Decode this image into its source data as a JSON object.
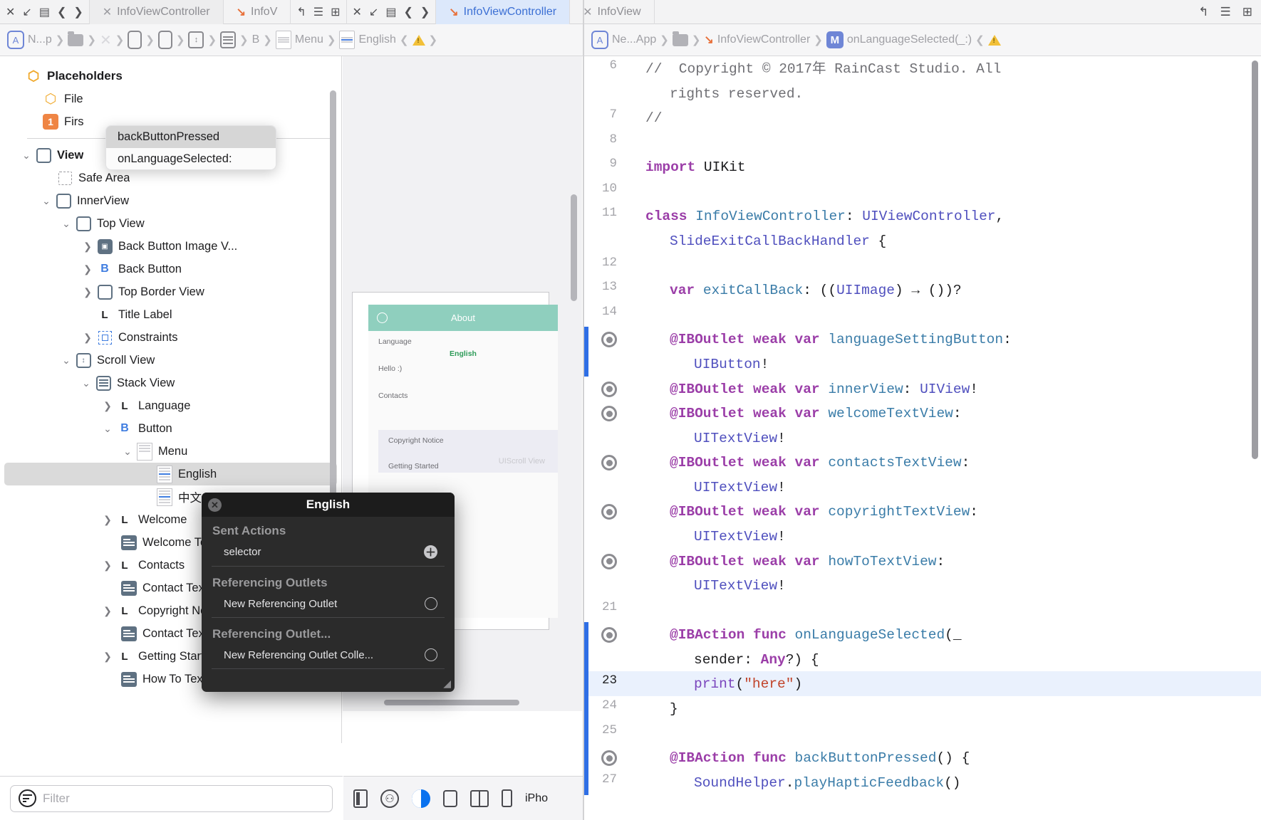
{
  "window": {
    "tabs": [
      {
        "label": "InfoViewController",
        "icon": "xib-icon",
        "state": "light"
      },
      {
        "label": "InfoV",
        "icon": "swift-icon",
        "state": "plain"
      },
      {
        "label": "InfoViewController",
        "icon": "swift-icon",
        "state": "active"
      },
      {
        "label": "InfoView",
        "icon": "xib-icon",
        "state": "plain"
      }
    ],
    "tab_controls": [
      "close-icon",
      "minimize-icon",
      "grid-icon",
      "back-chevron",
      "forward-chevron"
    ],
    "right_controls": [
      "undo-icon",
      "list-icon",
      "add-editor-icon"
    ]
  },
  "left_jumpbar": {
    "crumbs": [
      {
        "label": "N...p",
        "icon": "appstore-icon"
      },
      {
        "label": "",
        "icon": "folder-icon"
      },
      {
        "label": "",
        "icon": "storyboard-icon"
      },
      {
        "label": "",
        "icon": "viewcontroller-icon"
      },
      {
        "label": "",
        "icon": "view-icon"
      },
      {
        "label": "",
        "icon": "scrollview-icon"
      },
      {
        "label": "",
        "icon": "stackview-icon"
      },
      {
        "label": "B",
        "icon": "button-icon"
      },
      {
        "label": "Menu",
        "icon": "menu-icon"
      },
      {
        "label": "English",
        "icon": "menuitem-icon"
      }
    ],
    "warning_icon": "warning-triangle-icon"
  },
  "outline": {
    "placeholders_header": "Placeholders",
    "items": [
      {
        "label": "Placeholders",
        "icon": "placeholder-icon",
        "indent": 0,
        "twisty": "",
        "kind": "header"
      },
      {
        "label": "File",
        "icon": "placeholder-icon",
        "indent": 1,
        "twisty": "",
        "kind": "row"
      },
      {
        "label": "Firs",
        "icon": "first-responder-badge",
        "indent": 1,
        "twisty": "",
        "kind": "row"
      },
      {
        "label": "View",
        "icon": "view-square-icon",
        "indent": 0,
        "twisty": "down",
        "kind": "bold"
      },
      {
        "label": "Safe Area",
        "icon": "safe-area-icon",
        "indent": 1,
        "twisty": "",
        "kind": "row"
      },
      {
        "label": "InnerView",
        "icon": "view-square-icon",
        "indent": 1,
        "twisty": "down",
        "kind": "row"
      },
      {
        "label": "Top View",
        "icon": "view-square-icon",
        "indent": 2,
        "twisty": "down",
        "kind": "row"
      },
      {
        "label": "Back Button Image V...",
        "icon": "imageview-icon",
        "indent": 3,
        "twisty": "right",
        "kind": "row"
      },
      {
        "label": "Back Button",
        "icon": "button-b-icon",
        "indent": 3,
        "twisty": "right",
        "kind": "row"
      },
      {
        "label": "Top Border View",
        "icon": "view-square-icon",
        "indent": 3,
        "twisty": "right",
        "kind": "row"
      },
      {
        "label": "Title Label",
        "icon": "label-l-icon",
        "indent": 3,
        "twisty": "",
        "kind": "row"
      },
      {
        "label": "Constraints",
        "icon": "constraints-icon",
        "indent": 2,
        "twisty": "right",
        "kind": "row"
      },
      {
        "label": "Scroll View",
        "icon": "scrollview-icon",
        "indent": 2,
        "twisty": "down",
        "kind": "row"
      },
      {
        "label": "Stack View",
        "icon": "stackview-icon",
        "indent": 3,
        "twisty": "down",
        "kind": "row"
      },
      {
        "label": "Language",
        "icon": "label-l-icon",
        "indent": 4,
        "twisty": "right",
        "kind": "row"
      },
      {
        "label": "Button",
        "icon": "button-b-icon",
        "indent": 4,
        "twisty": "down",
        "kind": "row"
      },
      {
        "label": "Menu",
        "icon": "menu-icon",
        "indent": 5,
        "twisty": "down",
        "kind": "row"
      },
      {
        "label": "English",
        "icon": "menuitem-icon",
        "indent": 6,
        "twisty": "",
        "kind": "selected"
      },
      {
        "label": "中文",
        "icon": "menuitem-icon",
        "indent": 6,
        "twisty": "",
        "kind": "row"
      },
      {
        "label": "Welcome",
        "icon": "label-l-icon",
        "indent": 4,
        "twisty": "right",
        "kind": "row"
      },
      {
        "label": "Welcome Text View",
        "icon": "textview-icon",
        "indent": 4,
        "twisty": "",
        "kind": "row"
      },
      {
        "label": "Contacts",
        "icon": "label-l-icon",
        "indent": 4,
        "twisty": "right",
        "kind": "row"
      },
      {
        "label": "Contact Text View",
        "icon": "textview-icon",
        "indent": 4,
        "twisty": "",
        "kind": "row"
      },
      {
        "label": "Copyright Notice",
        "icon": "label-l-icon",
        "indent": 4,
        "twisty": "right",
        "kind": "row"
      },
      {
        "label": "Contact Text View",
        "icon": "textview-icon",
        "indent": 4,
        "twisty": "",
        "kind": "row"
      },
      {
        "label": "Getting Started",
        "icon": "label-l-icon",
        "indent": 4,
        "twisty": "right",
        "kind": "row"
      },
      {
        "label": "How To Text View",
        "icon": "textview-icon",
        "indent": 4,
        "twisty": "",
        "kind": "row"
      }
    ]
  },
  "action_popup": {
    "items": [
      {
        "label": "backButtonPressed",
        "highlighted": true
      },
      {
        "label": "onLanguageSelected:",
        "highlighted": false
      }
    ]
  },
  "connections_popup": {
    "title": "English",
    "close_icon": "close-icon",
    "sections": [
      {
        "header": "Sent Actions",
        "rows": [
          {
            "label": "selector",
            "control": "plus-circle-icon"
          }
        ]
      },
      {
        "header": "Referencing Outlets",
        "rows": [
          {
            "label": "New Referencing Outlet",
            "control": "empty-circle-icon"
          }
        ]
      },
      {
        "header": "Referencing Outlet...",
        "rows": [
          {
            "label": "New Referencing Outlet Colle...",
            "control": "empty-circle-icon"
          }
        ]
      }
    ],
    "resize_grip": "resize-grip-icon"
  },
  "canvas": {
    "device_title": "About",
    "back_icon": "back-circle-icon",
    "rows": [
      {
        "label": "Language",
        "style": "plain"
      },
      {
        "label": "English",
        "style": "green"
      },
      {
        "label": "Hello :)",
        "style": "plain"
      },
      {
        "label": "Contacts",
        "style": "plain"
      },
      {
        "label": "Copyright Notice",
        "style": "plain"
      },
      {
        "label": "Getting Started",
        "style": "plain"
      }
    ],
    "ghost_label": "UIScroll View"
  },
  "filter": {
    "placeholder": "Filter",
    "icon": "filter-icon"
  },
  "canvas_toolbar": {
    "buttons": [
      {
        "icon": "document-outline-icon",
        "active": false
      },
      {
        "icon": "accessibility-icon",
        "active": false
      },
      {
        "icon": "appearance-icon",
        "active": true
      },
      {
        "icon": "variants-icon",
        "active": false
      },
      {
        "icon": "split-preview-icon",
        "active": false
      },
      {
        "icon": "device-icon",
        "active": false
      }
    ],
    "device_label": "iPho"
  },
  "right_jumpbar": {
    "crumbs": [
      {
        "label": "Ne...App",
        "icon": "appstore-icon"
      },
      {
        "label": "",
        "icon": "folder-icon"
      },
      {
        "label": "InfoViewController",
        "icon": "swift-icon"
      },
      {
        "label": "onLanguageSelected(_:)",
        "icon": "method-m-icon"
      }
    ]
  },
  "editor": {
    "lines": [
      {
        "num": "6",
        "gutter": "num",
        "marker": false,
        "indent": 0,
        "tokens": [
          {
            "t": "//  Copyright © 2017年 RainCast Studio. All",
            "c": "cm"
          }
        ]
      },
      {
        "num": "",
        "gutter": "wrap",
        "marker": false,
        "indent": 1,
        "tokens": [
          {
            "t": "rights reserved.",
            "c": "cm"
          }
        ]
      },
      {
        "num": "7",
        "gutter": "num",
        "marker": false,
        "indent": 0,
        "tokens": [
          {
            "t": "//",
            "c": "cm"
          }
        ]
      },
      {
        "num": "8",
        "gutter": "num",
        "marker": false,
        "indent": 0,
        "tokens": []
      },
      {
        "num": "9",
        "gutter": "num",
        "marker": false,
        "indent": 0,
        "tokens": [
          {
            "t": "import",
            "c": "kw"
          },
          {
            "t": " UIKit",
            "c": ""
          }
        ]
      },
      {
        "num": "10",
        "gutter": "num",
        "marker": false,
        "indent": 0,
        "tokens": []
      },
      {
        "num": "11",
        "gutter": "num",
        "marker": false,
        "indent": 0,
        "tokens": [
          {
            "t": "class",
            "c": "kw"
          },
          {
            "t": " ",
            "c": ""
          },
          {
            "t": "InfoViewController",
            "c": "id"
          },
          {
            "t": ": ",
            "c": ""
          },
          {
            "t": "UIViewController",
            "c": "ty"
          },
          {
            "t": ",",
            "c": ""
          }
        ]
      },
      {
        "num": "",
        "gutter": "wrap",
        "marker": false,
        "indent": 1,
        "tokens": [
          {
            "t": "SlideExitCallBackHandler",
            "c": "ty"
          },
          {
            "t": " {",
            "c": ""
          }
        ]
      },
      {
        "num": "12",
        "gutter": "num",
        "marker": false,
        "indent": 0,
        "tokens": []
      },
      {
        "num": "13",
        "gutter": "num",
        "marker": false,
        "indent": 1,
        "tokens": [
          {
            "t": "var",
            "c": "kw"
          },
          {
            "t": " ",
            "c": ""
          },
          {
            "t": "exitCallBack",
            "c": "id"
          },
          {
            "t": ": ((",
            "c": ""
          },
          {
            "t": "UIImage",
            "c": "ty"
          },
          {
            "t": ") → ())?",
            "c": ""
          }
        ]
      },
      {
        "num": "14",
        "gutter": "num",
        "marker": false,
        "indent": 0,
        "tokens": []
      },
      {
        "num": "",
        "gutter": "bp",
        "marker": true,
        "indent": 1,
        "tokens": [
          {
            "t": "@IBOutlet weak var",
            "c": "kw"
          },
          {
            "t": " ",
            "c": ""
          },
          {
            "t": "languageSettingButton",
            "c": "id"
          },
          {
            "t": ":",
            "c": ""
          }
        ]
      },
      {
        "num": "",
        "gutter": "wrap",
        "marker": false,
        "indent": 2,
        "tokens": [
          {
            "t": "UIButton",
            "c": "ty"
          },
          {
            "t": "!",
            "c": ""
          }
        ]
      },
      {
        "num": "",
        "gutter": "bp",
        "marker": true,
        "indent": 1,
        "tokens": [
          {
            "t": "@IBOutlet weak var",
            "c": "kw"
          },
          {
            "t": " ",
            "c": ""
          },
          {
            "t": "innerView",
            "c": "id"
          },
          {
            "t": ": ",
            "c": ""
          },
          {
            "t": "UIView",
            "c": "ty"
          },
          {
            "t": "!",
            "c": ""
          }
        ]
      },
      {
        "num": "",
        "gutter": "bp",
        "marker": true,
        "indent": 1,
        "tokens": [
          {
            "t": "@IBOutlet weak var",
            "c": "kw"
          },
          {
            "t": " ",
            "c": ""
          },
          {
            "t": "welcomeTextView",
            "c": "id"
          },
          {
            "t": ":",
            "c": ""
          }
        ]
      },
      {
        "num": "",
        "gutter": "wrap",
        "marker": false,
        "indent": 2,
        "tokens": [
          {
            "t": "UITextView",
            "c": "ty"
          },
          {
            "t": "!",
            "c": ""
          }
        ]
      },
      {
        "num": "",
        "gutter": "bp",
        "marker": true,
        "indent": 1,
        "tokens": [
          {
            "t": "@IBOutlet weak var",
            "c": "kw"
          },
          {
            "t": " ",
            "c": ""
          },
          {
            "t": "contactsTextView",
            "c": "id"
          },
          {
            "t": ":",
            "c": ""
          }
        ]
      },
      {
        "num": "",
        "gutter": "wrap",
        "marker": false,
        "indent": 2,
        "tokens": [
          {
            "t": "UITextView",
            "c": "ty"
          },
          {
            "t": "!",
            "c": ""
          }
        ]
      },
      {
        "num": "",
        "gutter": "bp",
        "marker": true,
        "indent": 1,
        "tokens": [
          {
            "t": "@IBOutlet weak var",
            "c": "kw"
          },
          {
            "t": " ",
            "c": ""
          },
          {
            "t": "copyrightTextView",
            "c": "id"
          },
          {
            "t": ":",
            "c": ""
          }
        ]
      },
      {
        "num": "",
        "gutter": "wrap",
        "marker": false,
        "indent": 2,
        "tokens": [
          {
            "t": "UITextView",
            "c": "ty"
          },
          {
            "t": "!",
            "c": ""
          }
        ]
      },
      {
        "num": "",
        "gutter": "bp",
        "marker": true,
        "indent": 1,
        "tokens": [
          {
            "t": "@IBOutlet weak var",
            "c": "kw"
          },
          {
            "t": " ",
            "c": ""
          },
          {
            "t": "howToTextView",
            "c": "id"
          },
          {
            "t": ":",
            "c": ""
          }
        ]
      },
      {
        "num": "",
        "gutter": "wrap",
        "marker": false,
        "indent": 2,
        "tokens": [
          {
            "t": "UITextView",
            "c": "ty"
          },
          {
            "t": "!",
            "c": ""
          }
        ]
      },
      {
        "num": "21",
        "gutter": "num",
        "marker": false,
        "indent": 0,
        "tokens": []
      },
      {
        "num": "",
        "gutter": "bp",
        "marker": true,
        "indent": 1,
        "tokens": [
          {
            "t": "@IBAction func",
            "c": "kw"
          },
          {
            "t": " ",
            "c": ""
          },
          {
            "t": "onLanguageSelected",
            "c": "id"
          },
          {
            "t": "(_",
            "c": ""
          }
        ]
      },
      {
        "num": "",
        "gutter": "wrap",
        "marker": false,
        "indent": 2,
        "tokens": [
          {
            "t": "sender: ",
            "c": ""
          },
          {
            "t": "Any",
            "c": "kw"
          },
          {
            "t": "?) {",
            "c": ""
          }
        ]
      },
      {
        "num": "23",
        "gutter": "num",
        "marker": false,
        "indent": 2,
        "highlight": true,
        "tokens": [
          {
            "t": "print",
            "c": "fn"
          },
          {
            "t": "(",
            "c": ""
          },
          {
            "t": "\"here\"",
            "c": "st"
          },
          {
            "t": ")",
            "c": ""
          }
        ]
      },
      {
        "num": "24",
        "gutter": "num",
        "marker": false,
        "indent": 1,
        "tokens": [
          {
            "t": "}",
            "c": ""
          }
        ]
      },
      {
        "num": "25",
        "gutter": "num",
        "marker": false,
        "indent": 0,
        "tokens": []
      },
      {
        "num": "",
        "gutter": "bp",
        "marker": true,
        "indent": 1,
        "tokens": [
          {
            "t": "@IBAction func",
            "c": "kw"
          },
          {
            "t": " ",
            "c": ""
          },
          {
            "t": "backButtonPressed",
            "c": "id"
          },
          {
            "t": "() {",
            "c": ""
          }
        ]
      },
      {
        "num": "27",
        "gutter": "num",
        "marker": false,
        "indent": 2,
        "tokens": [
          {
            "t": "SoundHelper",
            "c": "ty"
          },
          {
            "t": ".",
            "c": ""
          },
          {
            "t": "playHapticFeedback",
            "c": "id"
          },
          {
            "t": "()",
            "c": ""
          }
        ]
      }
    ]
  },
  "colors": {
    "accent_blue": "#2f6fe5",
    "keyword_purple": "#9b3ea8",
    "type_indigo": "#4f4fbe",
    "identifier_blue": "#3a7ca8",
    "string_red": "#c1442a",
    "comment_gray": "#6f6f74",
    "selection_gray": "#dadada",
    "popup_dark": "#2b2b2b"
  }
}
